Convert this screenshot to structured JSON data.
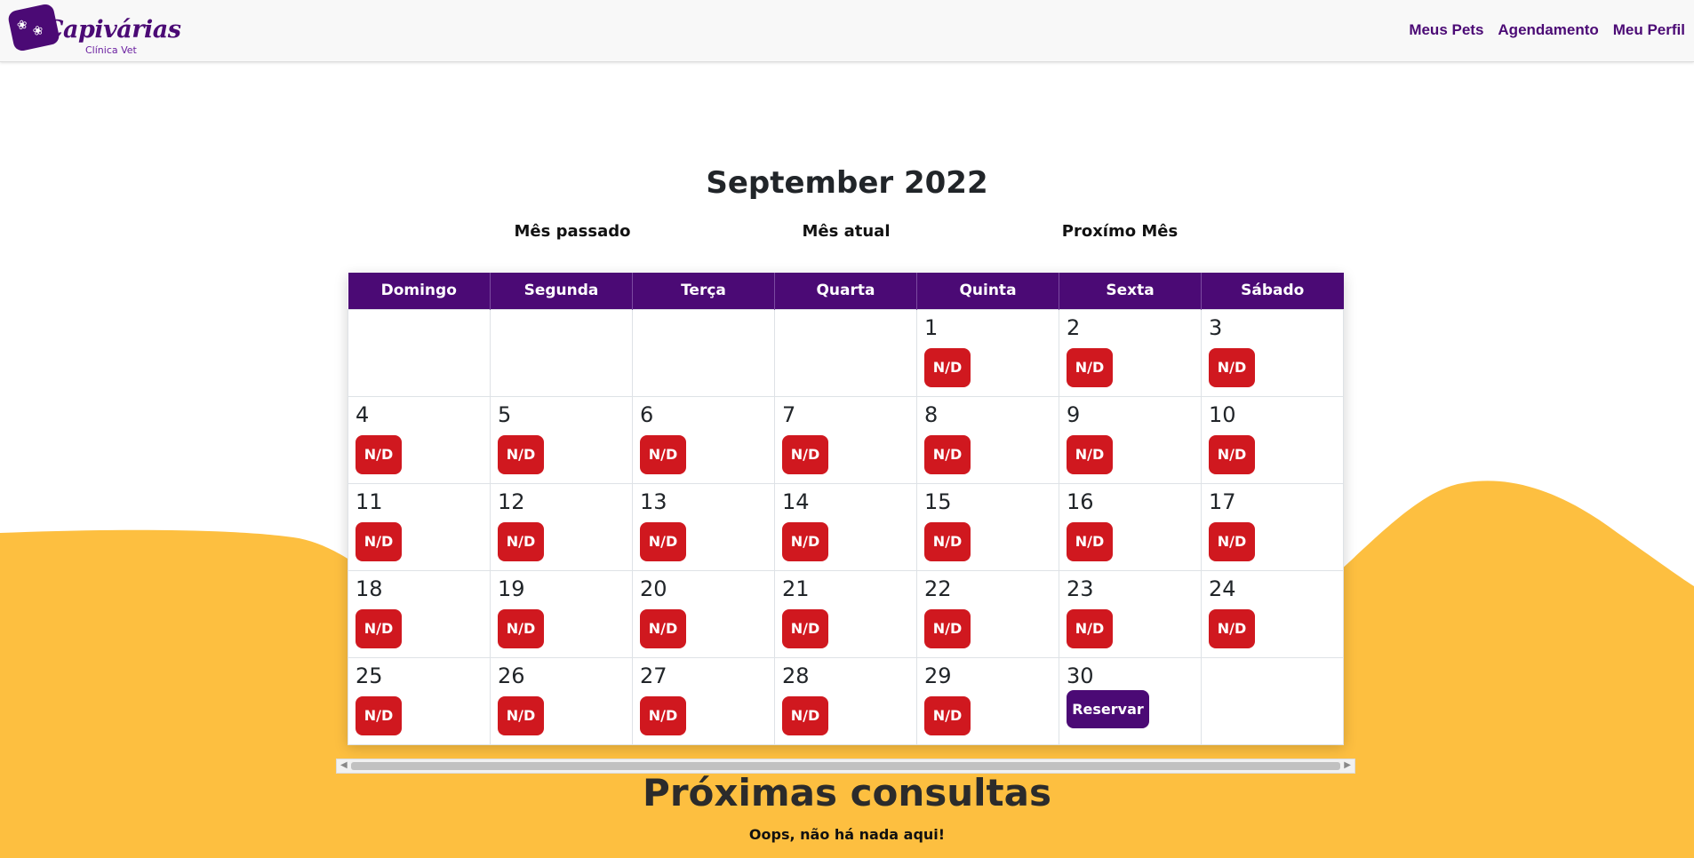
{
  "brand": {
    "name": "Capivárias",
    "subtitle": "Clínica Vet",
    "primary_color": "#4b0a75",
    "accent_color": "#fdbf40",
    "danger_color": "#d0181f"
  },
  "nav": {
    "links": [
      "Meus Pets",
      "Agendamento",
      "Meu Perfil"
    ]
  },
  "calendar": {
    "month_title": "September 2022",
    "prev_label": "Mês passado",
    "current_label": "Mês atual",
    "next_label": "Proxímo Mês",
    "weekdays": [
      "Domingo",
      "Segunda",
      "Terça",
      "Quarta",
      "Quinta",
      "Sexta",
      "Sábado"
    ],
    "first_weekday_index": 4,
    "days_in_month": 30,
    "unavailable_label": "N/D",
    "reserve_label": "Reservar",
    "reservable_days": [
      30
    ]
  },
  "appointments": {
    "title": "Próximas consultas",
    "empty_message": "Oops, não há nada aqui!"
  }
}
